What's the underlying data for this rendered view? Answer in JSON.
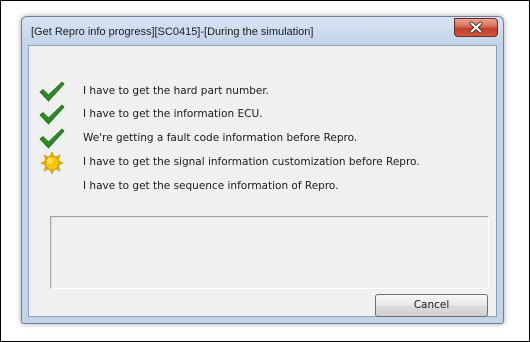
{
  "dialog": {
    "title": "[Get Repro info progress][SC0415]-[During the simulation]",
    "close_icon": "close-x-icon"
  },
  "steps": [
    {
      "label": "I have to get the hard part number.",
      "status": "done",
      "icon": "checkmark-icon"
    },
    {
      "label": "I have to get the information ECU.",
      "status": "done",
      "icon": "checkmark-icon"
    },
    {
      "label": "We're getting a fault code information before Repro.",
      "status": "done",
      "icon": "checkmark-icon"
    },
    {
      "label": "I have to get the signal information customization before Repro.",
      "status": "in-progress",
      "icon": "sun-progress-icon"
    },
    {
      "label": "I have to get the sequence information of Repro.",
      "status": "pending",
      "icon": ""
    }
  ],
  "log": {
    "text": ""
  },
  "buttons": {
    "cancel_label": "Cancel"
  },
  "colors": {
    "check_green": "#2e8b25",
    "progress_yellow": "#f5c400",
    "close_red": "#c3402a"
  }
}
